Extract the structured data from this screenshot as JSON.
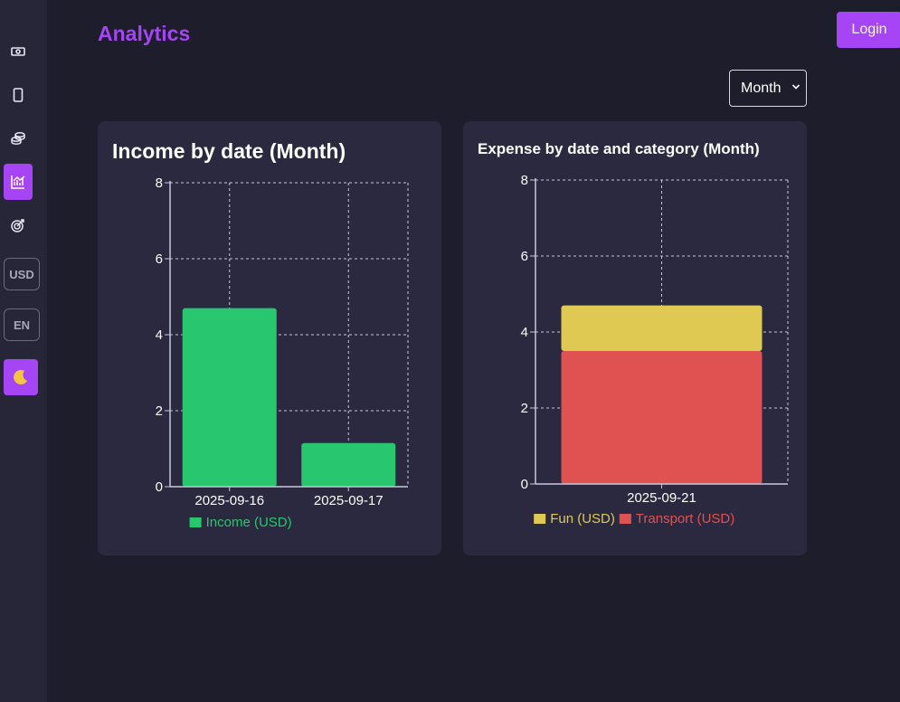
{
  "header": {
    "title": "Analytics",
    "login_label": "Login"
  },
  "sidebar": {
    "items": [
      {
        "icon": "banknote-icon"
      },
      {
        "icon": "tablet-icon"
      },
      {
        "icon": "coins-icon"
      },
      {
        "icon": "chart-icon",
        "active": true
      },
      {
        "icon": "target-icon"
      },
      {
        "label": "USD"
      },
      {
        "label": "EN"
      },
      {
        "icon": "moon-icon"
      }
    ]
  },
  "filters": {
    "period": "Month"
  },
  "colors": {
    "accent": "#a545f5",
    "income": "#28c76f",
    "fun": "#e0c952",
    "transport": "#e05252"
  },
  "chart_data": [
    {
      "type": "bar",
      "title": "Income by date (Month)",
      "categories": [
        "2025-09-16",
        "2025-09-17"
      ],
      "series": [
        {
          "name": "Income (USD)",
          "values": [
            4.7,
            1.15
          ],
          "color": "#28c76f"
        }
      ],
      "ylim": [
        0,
        8
      ],
      "yticks": [
        "0",
        "2",
        "4",
        "6",
        "8"
      ],
      "grid": true,
      "legend": "bottom"
    },
    {
      "type": "bar",
      "stacked": true,
      "title": "Expense by date and category (Month)",
      "categories": [
        "2025-09-21"
      ],
      "series": [
        {
          "name": "Transport (USD)",
          "values": [
            3.5
          ],
          "color": "#e05252"
        },
        {
          "name": "Fun (USD)",
          "values": [
            1.2
          ],
          "color": "#e0c952"
        }
      ],
      "legend_order": [
        "Fun (USD)",
        "Transport (USD)"
      ],
      "ylim": [
        0,
        8
      ],
      "yticks": [
        "0",
        "2",
        "4",
        "6",
        "8"
      ],
      "grid": true,
      "legend": "bottom"
    }
  ]
}
